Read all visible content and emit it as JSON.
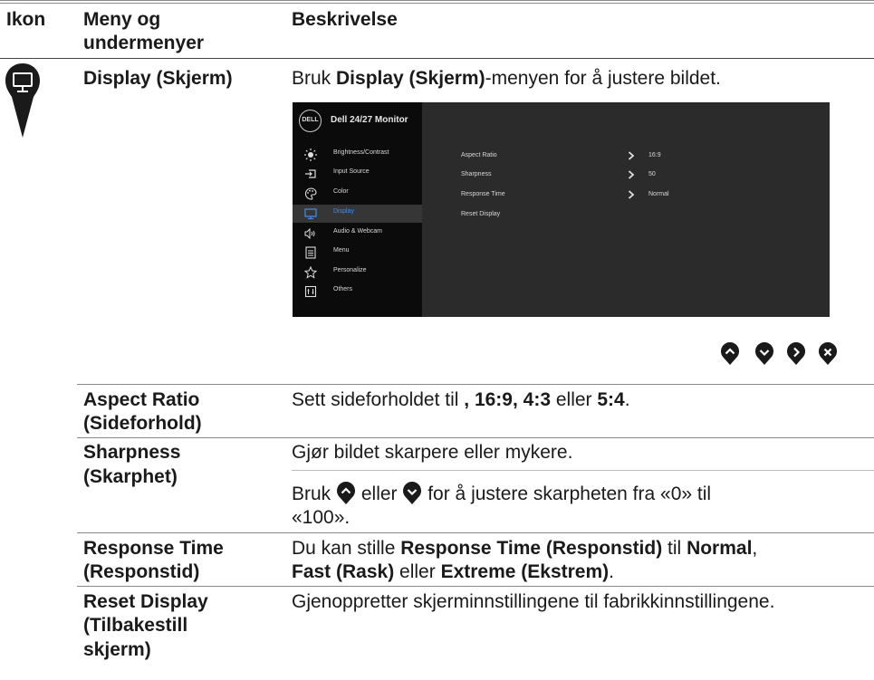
{
  "header": {
    "col_icon": "Ikon",
    "col_menu_line1": "Meny og",
    "col_menu_line2": "undermenyer",
    "col_desc": "Beskrivelse"
  },
  "display_row": {
    "menu": "Display (Skjerm)",
    "desc_pre": "Bruk ",
    "desc_bold": "Display (Skjerm)",
    "desc_post": "-menyen for å justere bildet."
  },
  "osd": {
    "logo": "DELL",
    "title": "Dell 24/27 Monitor",
    "menu_items": [
      {
        "label": "Brightness/Contrast",
        "icon": "sun-icon"
      },
      {
        "label": "Input Source",
        "icon": "input-source-icon"
      },
      {
        "label": "Color",
        "icon": "palette-icon"
      },
      {
        "label": "Display",
        "icon": "monitor-icon",
        "selected": true
      },
      {
        "label": "Audio & Webcam",
        "icon": "speaker-icon"
      },
      {
        "label": "Menu",
        "icon": "menu-icon"
      },
      {
        "label": "Personalize",
        "icon": "star-icon"
      },
      {
        "label": "Others",
        "icon": "others-icon"
      }
    ],
    "settings": [
      {
        "label": "Aspect Ratio",
        "value": "16:9"
      },
      {
        "label": "Sharpness",
        "value": "50"
      },
      {
        "label": "Response Time",
        "value": "Normal"
      },
      {
        "label": "Reset Display",
        "value": ""
      }
    ],
    "accent": "#3d8ff0"
  },
  "nav_buttons": [
    "up-button",
    "down-button",
    "right-button",
    "close-button"
  ],
  "rows": {
    "aspect": {
      "menu1": "Aspect Ratio",
      "menu2": "(Sideforhold)",
      "desc_pre": "Sett sideforholdet til ",
      "desc_b1": ", 16:9, 4:3",
      "desc_mid": " eller ",
      "desc_b2": "5:4",
      "desc_end": "."
    },
    "sharpness": {
      "menu1": "Sharpness",
      "menu2": "(Skarphet)",
      "desc1": "Gjør bildet skarpere eller mykere.",
      "desc2_pre": "Bruk ",
      "desc2_mid": " eller ",
      "desc2_post": " for å justere skarpheten fra «0» til",
      "desc3": "«100»."
    },
    "response": {
      "menu1": "Response Time",
      "menu2": "(Responstid)",
      "l1_pre": "Du kan stille ",
      "l1_b1": "Response Time (Responstid)",
      "l1_mid": " til ",
      "l1_b2": "Normal",
      "l1_end": ",",
      "l2_b1": "Fast (Rask)",
      "l2_mid": " eller ",
      "l2_b2": "Extreme (Ekstrem)",
      "l2_end": "."
    },
    "reset": {
      "menu1": "Reset Display",
      "menu2": "(Tilbakestill",
      "menu3": "skjerm)",
      "desc": "Gjenoppretter skjerminnstillingene til fabrikkinnstillingene."
    }
  },
  "colors": {
    "nav_button": "#1a1a1a",
    "rule": "#8a8a8a"
  }
}
